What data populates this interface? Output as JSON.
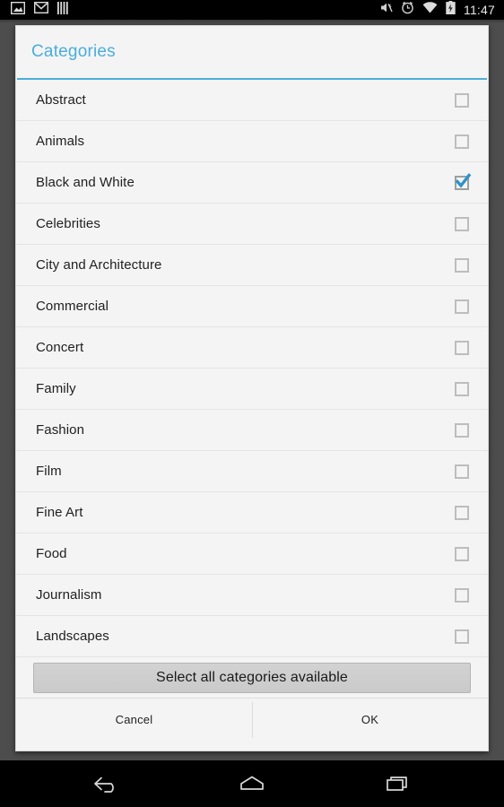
{
  "status_bar": {
    "left_icons": [
      {
        "name": "screenshot-icon",
        "label": "Screenshot"
      },
      {
        "name": "gmail-icon",
        "label": "Gmail"
      },
      {
        "name": "bars-icon",
        "label": "Bars"
      }
    ],
    "right_icons": [
      {
        "name": "mute-icon",
        "label": "Muted"
      },
      {
        "name": "alarm-icon",
        "label": "Alarm set"
      },
      {
        "name": "wifi-icon",
        "label": "Wi-Fi"
      },
      {
        "name": "battery-charging-icon",
        "label": "Battery charging"
      }
    ],
    "time": "11:47"
  },
  "dialog": {
    "title": "Categories",
    "accent_color": "#4aaedb",
    "background_color": "#f4f4f4",
    "items": [
      {
        "label": "Abstract",
        "checked": false
      },
      {
        "label": "Animals",
        "checked": false
      },
      {
        "label": "Black and White",
        "checked": true
      },
      {
        "label": "Celebrities",
        "checked": false
      },
      {
        "label": "City and Architecture",
        "checked": false
      },
      {
        "label": "Commercial",
        "checked": false
      },
      {
        "label": "Concert",
        "checked": false
      },
      {
        "label": "Family",
        "checked": false
      },
      {
        "label": "Fashion",
        "checked": false
      },
      {
        "label": "Film",
        "checked": false
      },
      {
        "label": "Fine Art",
        "checked": false
      },
      {
        "label": "Food",
        "checked": false
      },
      {
        "label": "Journalism",
        "checked": false
      },
      {
        "label": "Landscapes",
        "checked": false
      }
    ],
    "select_all_label": "Select all categories available",
    "cancel_label": "Cancel",
    "ok_label": "OK"
  },
  "nav_bar": {
    "buttons": [
      {
        "name": "back-icon",
        "label": "Back"
      },
      {
        "name": "home-icon",
        "label": "Home"
      },
      {
        "name": "recents-icon",
        "label": "Recent apps"
      }
    ]
  }
}
